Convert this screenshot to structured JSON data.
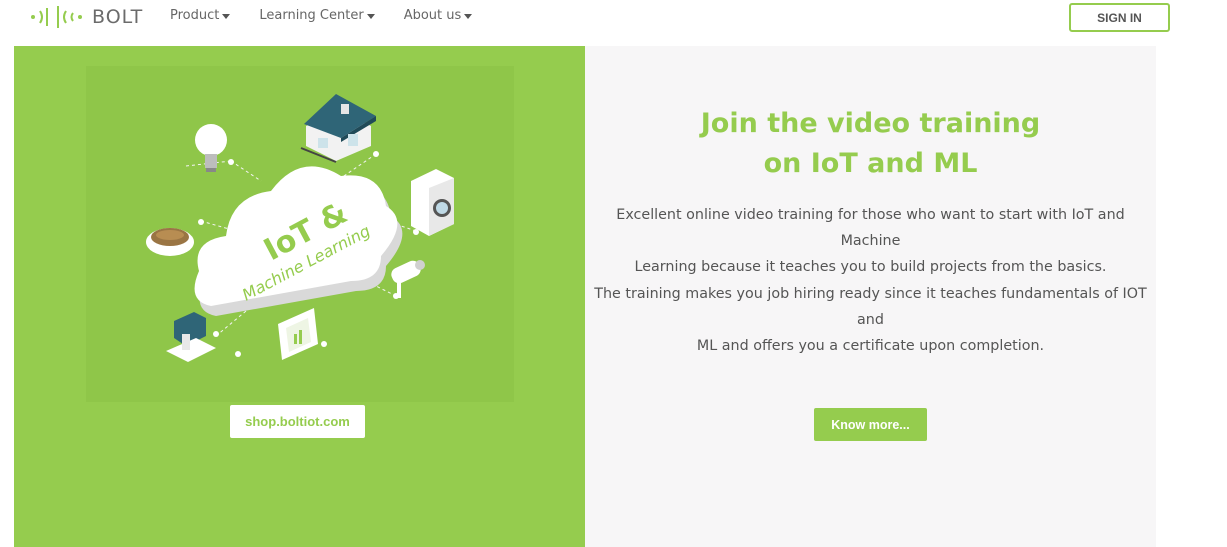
{
  "header": {
    "logo_text": "BOLT",
    "nav": [
      {
        "label": "Product"
      },
      {
        "label": "Learning Center"
      },
      {
        "label": "About us"
      }
    ],
    "signin_label": "SIGN IN"
  },
  "promo": {
    "illustration": {
      "cloud_line1": "IoT &",
      "cloud_line2": "Machine Learning"
    },
    "shop_label": "shop.boltiot.com"
  },
  "training": {
    "headline_line1": "Join the video training",
    "headline_line2": "on IoT and ML",
    "para1_line1": "Excellent online video training for those who want to start with IoT and Machine",
    "para1_line2": "Learning because it teaches you to build projects from the basics.",
    "para2_line1": "The training makes you job hiring ready since it teaches fundamentals of IOT and",
    "para2_line2": "ML and offers you a certificate upon completion.",
    "cta_label": "Know more..."
  },
  "colors": {
    "brand_green": "#95cc4e",
    "panel_gray": "#f7f6f7",
    "text_gray": "#555555"
  }
}
